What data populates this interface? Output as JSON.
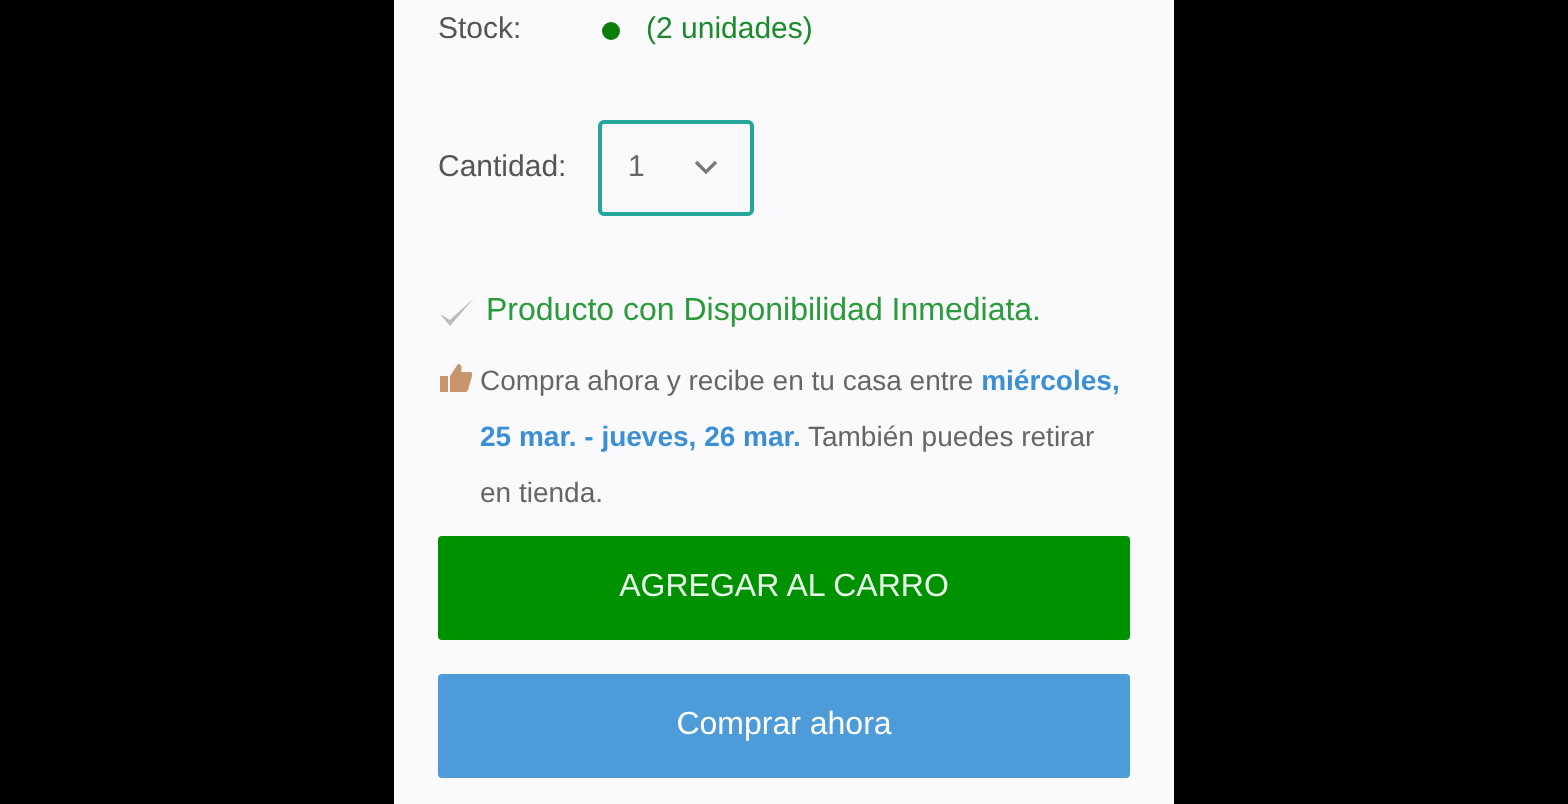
{
  "stock": {
    "label": "Stock:",
    "color": "#0a7d0a",
    "value": "(2 unidades)"
  },
  "quantity": {
    "label": "Cantidad:",
    "value": "1"
  },
  "availability": "Producto con Disponibilidad Inmediata.",
  "delivery": "Compra ahora y recibe en tu casa entre **miércoles, 25 mar. - jueves, 26 mar.** También puedes retirar en tienda.",
  "buttons": [
    {
      "label": "AGREGAR AL CARRO",
      "kind": "primary"
    },
    {
      "label": "Comprar ahora",
      "kind": "secondary"
    }
  ]
}
